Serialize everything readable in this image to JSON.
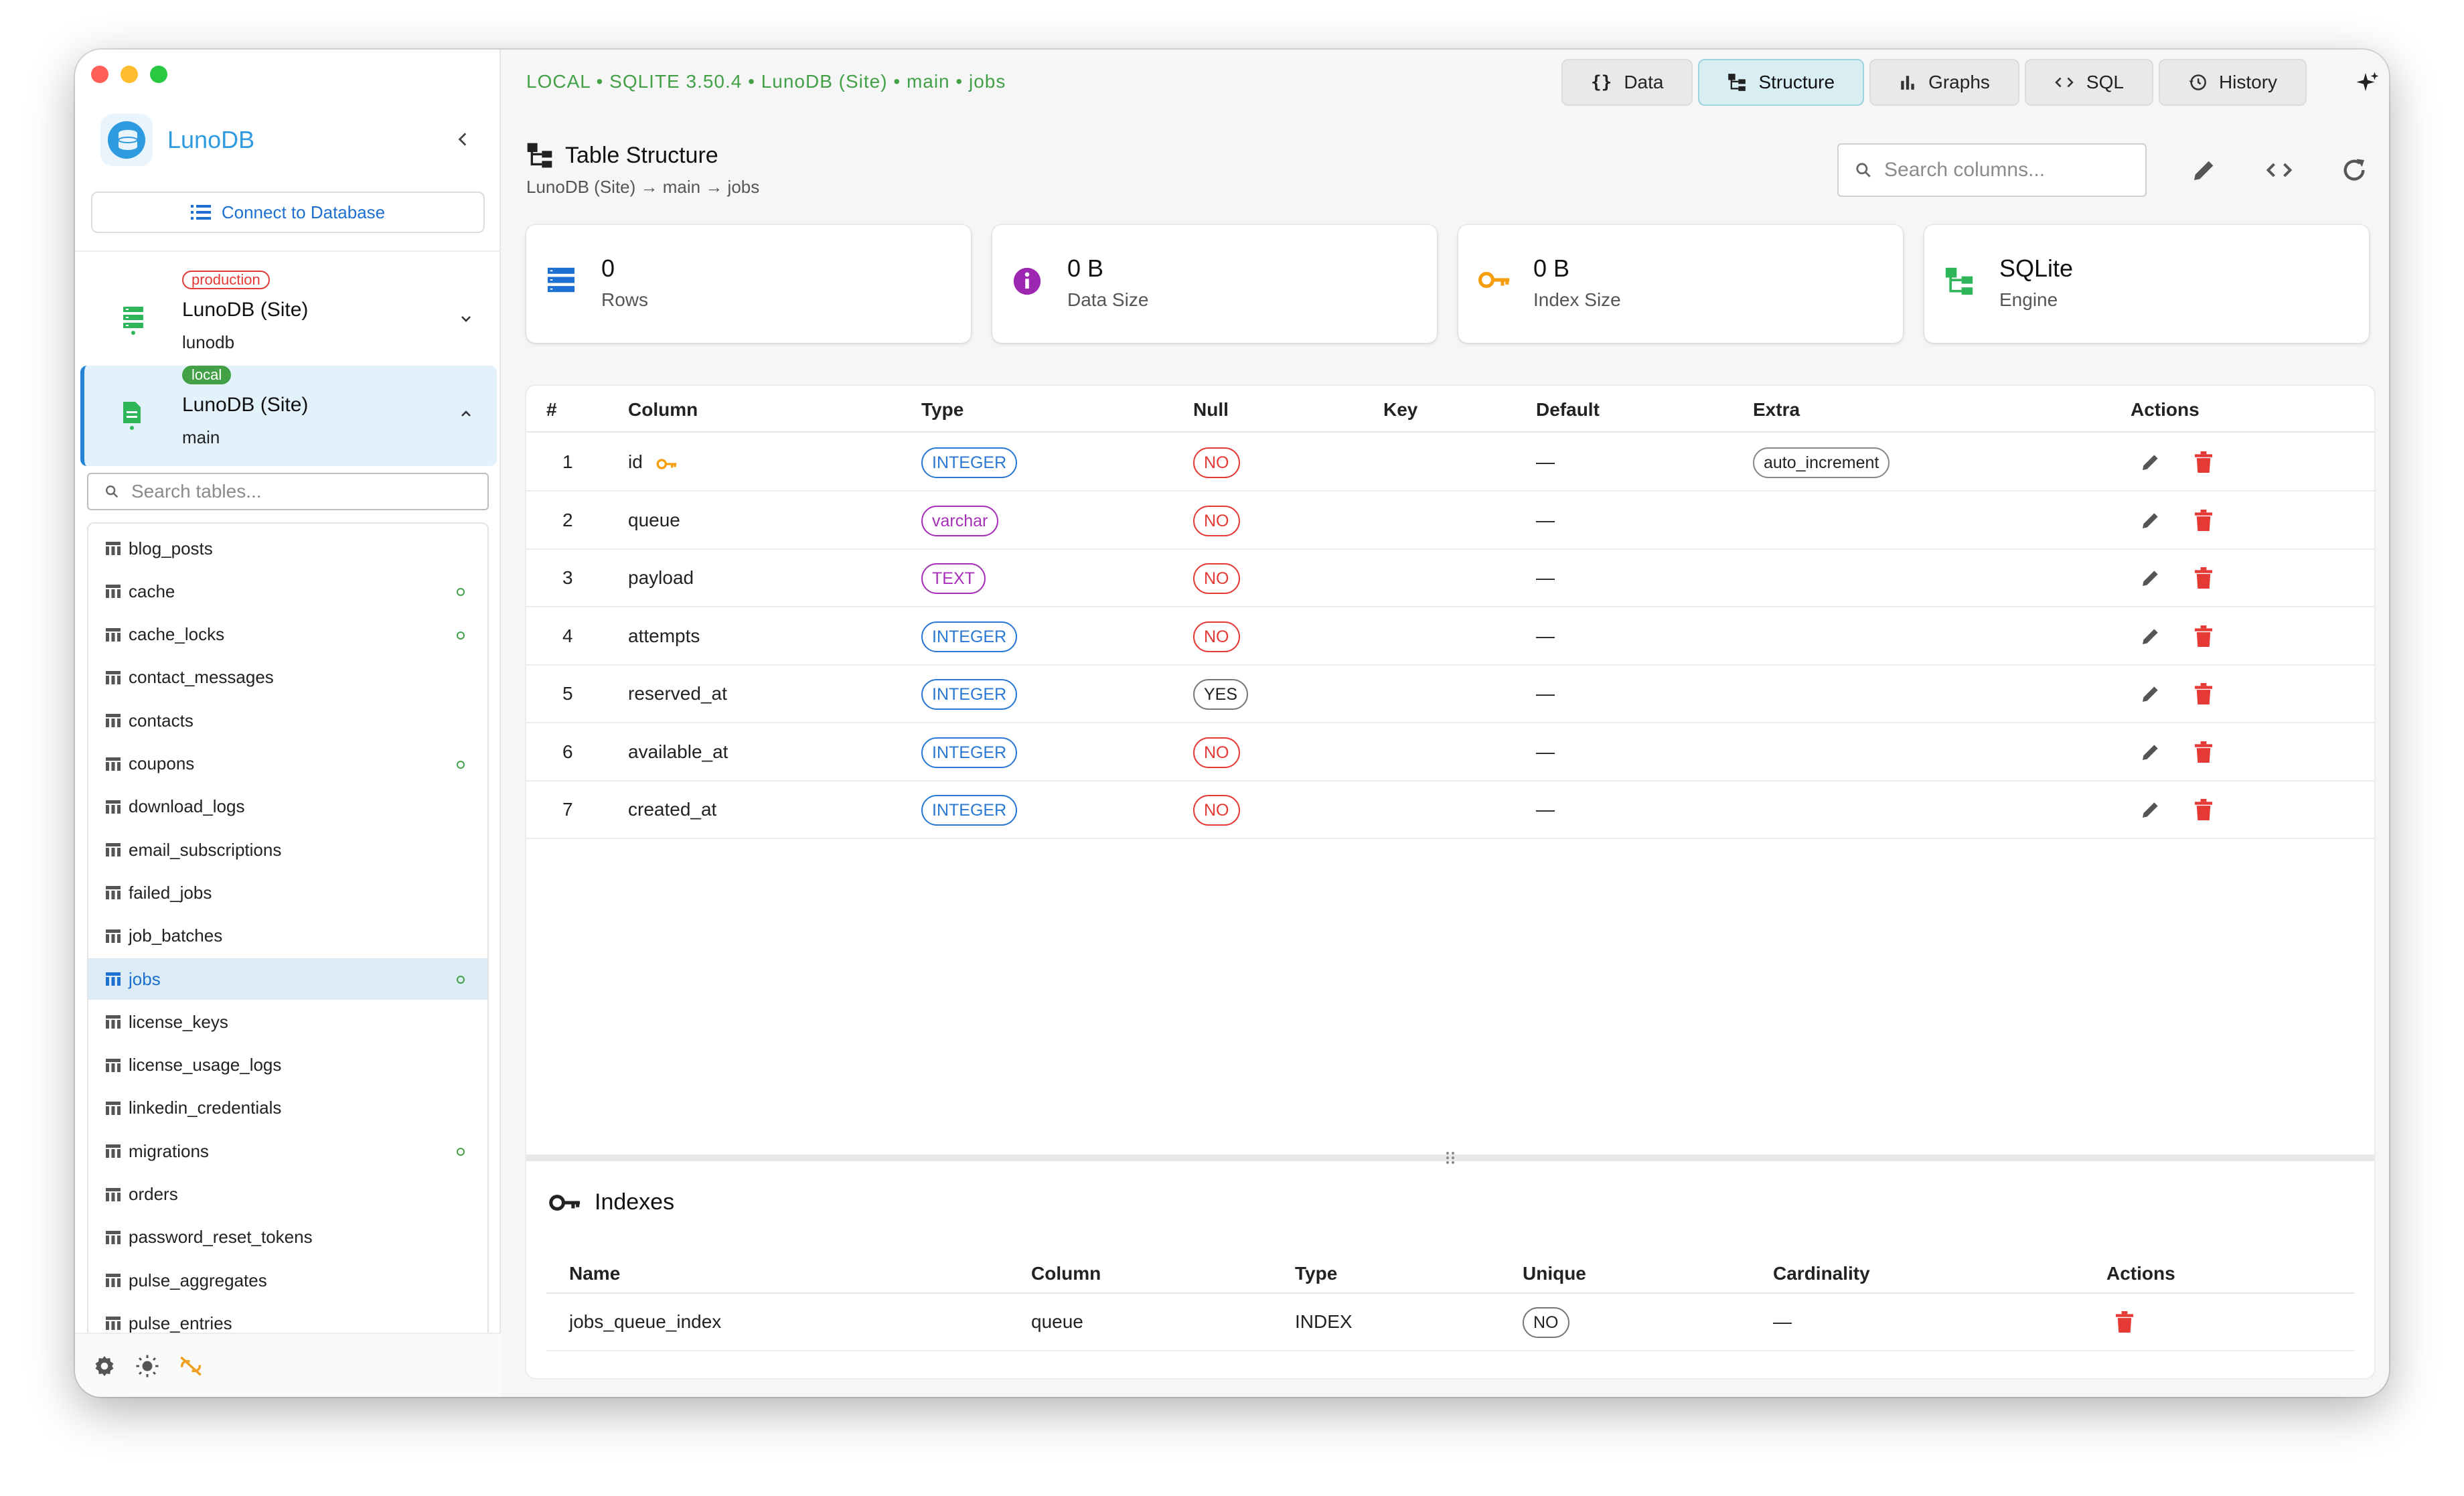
{
  "app": {
    "name": "LunoDB"
  },
  "sidebar": {
    "connect_label": "Connect to Database",
    "connections": [
      {
        "badge": "production",
        "name": "LunoDB (Site)",
        "sub": "lunodb"
      },
      {
        "badge": "local",
        "name": "LunoDB (Site)",
        "sub": "main"
      }
    ],
    "search_placeholder": "Search tables...",
    "tables": [
      "blog_posts",
      "cache",
      "cache_locks",
      "contact_messages",
      "contacts",
      "coupons",
      "download_logs",
      "email_subscriptions",
      "failed_jobs",
      "job_batches",
      "jobs",
      "license_keys",
      "license_usage_logs",
      "linkedin_credentials",
      "migrations",
      "orders",
      "password_reset_tokens",
      "pulse_aggregates",
      "pulse_entries"
    ]
  },
  "header": {
    "context": "LOCAL • SQLITE 3.50.4 • LunoDB (Site) • main • jobs",
    "tabs": [
      "Data",
      "Structure",
      "Graphs",
      "SQL",
      "History"
    ],
    "title": "Table Structure",
    "path": "LunoDB (Site) → main → jobs",
    "search_placeholder": "Search columns..."
  },
  "stats": [
    {
      "value": "0",
      "label": "Rows"
    },
    {
      "value": "0 B",
      "label": "Data Size"
    },
    {
      "value": "0 B",
      "label": "Index Size"
    },
    {
      "value": "SQLite",
      "label": "Engine"
    }
  ],
  "columns_table": {
    "headers": [
      "#",
      "Column",
      "Type",
      "Null",
      "Key",
      "Default",
      "Extra",
      "Actions"
    ],
    "rows": [
      {
        "n": "1",
        "name": "id",
        "type": "INTEGER",
        "null": "NO",
        "default": "—",
        "extra": "auto_increment"
      },
      {
        "n": "2",
        "name": "queue",
        "type": "varchar",
        "null": "NO",
        "default": "—",
        "extra": ""
      },
      {
        "n": "3",
        "name": "payload",
        "type": "TEXT",
        "null": "NO",
        "default": "—",
        "extra": ""
      },
      {
        "n": "4",
        "name": "attempts",
        "type": "INTEGER",
        "null": "NO",
        "default": "—",
        "extra": ""
      },
      {
        "n": "5",
        "name": "reserved_at",
        "type": "INTEGER",
        "null": "YES",
        "default": "—",
        "extra": ""
      },
      {
        "n": "6",
        "name": "available_at",
        "type": "INTEGER",
        "null": "NO",
        "default": "—",
        "extra": ""
      },
      {
        "n": "7",
        "name": "created_at",
        "type": "INTEGER",
        "null": "NO",
        "default": "—",
        "extra": ""
      }
    ]
  },
  "indexes": {
    "title": "Indexes",
    "headers": [
      "Name",
      "Column",
      "Type",
      "Unique",
      "Cardinality",
      "Actions"
    ],
    "rows": [
      {
        "name": "jobs_queue_index",
        "column": "queue",
        "type": "INDEX",
        "unique": "NO",
        "cardinality": "—"
      }
    ]
  },
  "colors": {
    "accent": "#2583d6",
    "green": "#43a047",
    "danger": "#e53935",
    "key": "#f59e0b",
    "purple": "#9c27b0"
  }
}
